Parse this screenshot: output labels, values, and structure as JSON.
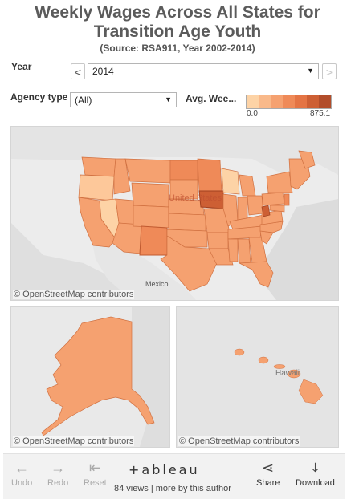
{
  "title": {
    "line1": "Weekly Wages Across All States for",
    "line2": "Transition Age Youth",
    "subtitle": "(Source: RSA911, Year 2002-2014)"
  },
  "year_filter": {
    "label": "Year",
    "value": "2014",
    "prev": "<",
    "next": ">"
  },
  "agency_filter": {
    "label": "Agency type",
    "value": "(All)"
  },
  "legend": {
    "label": "Avg. Wee...",
    "min": "0.0",
    "max": "875.1",
    "colors": [
      "#fdd3a6",
      "#f9b98a",
      "#f5a170",
      "#ef8a58",
      "#e47444",
      "#cd5f34",
      "#b24d2b"
    ]
  },
  "maps": {
    "main": {
      "attribution": "© OpenStreetMap contributors",
      "labels": [
        "United States",
        "Mexico"
      ]
    },
    "alaska": {
      "attribution": "© OpenStreetMap contributors"
    },
    "hawaii": {
      "attribution": "© OpenStreetMap contributors",
      "label": "Hawaii"
    }
  },
  "toolbar": {
    "undo": "Undo",
    "redo": "Redo",
    "reset": "Reset",
    "brand": "+ableau",
    "views": "84 views | more by this author",
    "share": "Share",
    "download": "Download"
  }
}
